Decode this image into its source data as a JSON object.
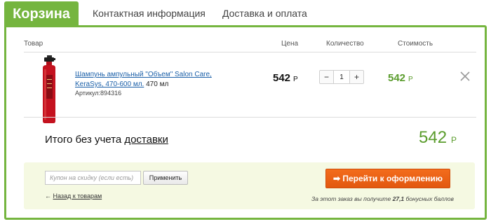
{
  "tabs": {
    "cart": "Корзина",
    "contact": "Контактная информация",
    "delivery": "Доставка и оплата"
  },
  "table": {
    "headers": {
      "product": "Товар",
      "price": "Цена",
      "quantity": "Количество",
      "cost": "Стоимость"
    }
  },
  "item": {
    "name_link": "Шампунь ампульный \"Объем\" Salon Care, KeraSys, 470-600 мл.",
    "volume": "470 мл",
    "sku": "Артикул:894316",
    "price": "542",
    "quantity": "1",
    "cost": "542",
    "currency": "Р"
  },
  "stepper": {
    "minus": "−",
    "plus": "+"
  },
  "total": {
    "label_prefix": "Итого без учета ",
    "label_link": "доставки",
    "value": "542",
    "currency": "Р"
  },
  "coupon": {
    "placeholder": "Купон на скидку (если есть)",
    "apply_label": "Применить"
  },
  "back_link": {
    "arrow": "←",
    "label": "Назад к товарам"
  },
  "checkout": {
    "arrow": "➡",
    "label": "Перейти к оформлению"
  },
  "bonus": {
    "prefix": "За этот заказ вы получите ",
    "amount": "27,1",
    "suffix": " бонусных баллов"
  },
  "colors": {
    "accent_green": "#75b53f",
    "price_green": "#5a9c2c",
    "checkout_orange": "#f36c1c"
  },
  "icons": {
    "remove": "close-icon",
    "product": "shampoo-bottle-image"
  }
}
